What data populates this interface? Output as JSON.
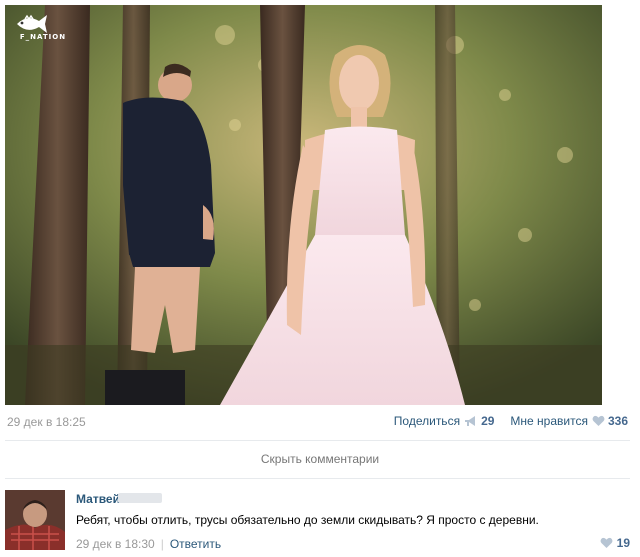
{
  "watermark": {
    "text": "F_NATION"
  },
  "post": {
    "date": "29 дек в 18:25",
    "share_label": "Поделиться",
    "share_count": "29",
    "like_label": "Мне нравится",
    "like_count": "336"
  },
  "hide_comments_label": "Скрыть комментарии",
  "comment": {
    "author": "Матвей",
    "text": "Ребят, чтобы отлить, трусы обязательно до земли скидывать? Я просто с деревни.",
    "date": "29 дек в 18:30",
    "separator": "|",
    "reply_label": "Ответить",
    "like_count": "19"
  },
  "colors": {
    "link": "#2b587a",
    "muted": "#999999",
    "heart": "#b6c4d3"
  }
}
